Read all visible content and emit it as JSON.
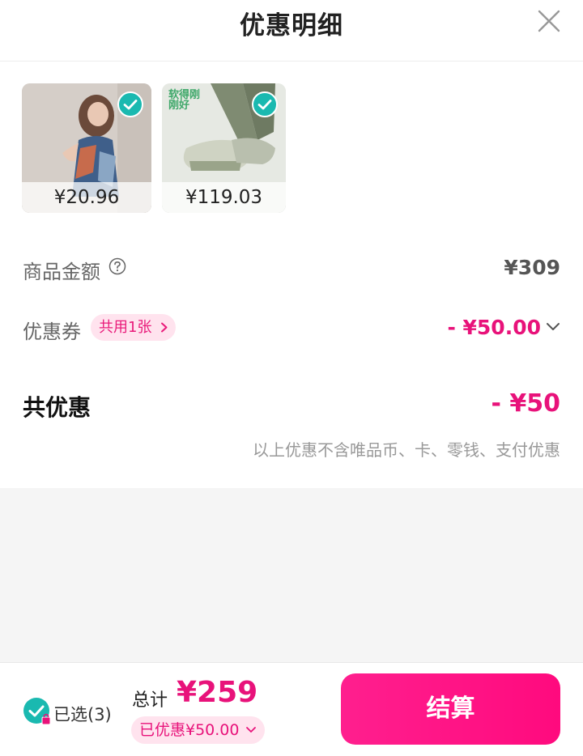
{
  "header": {
    "title": "优惠明细",
    "close_icon": "close-icon"
  },
  "products": [
    {
      "price": "¥20.96",
      "selected": true
    },
    {
      "price": "¥119.03",
      "selected": true,
      "brand_text": "软得刚刚好"
    }
  ],
  "summary": {
    "goods_amount_label": "商品金额",
    "goods_amount_value": "¥309",
    "coupon_label": "优惠券",
    "coupon_tag": "共用1张",
    "coupon_value": "- ¥50.00",
    "total_discount_label": "共优惠",
    "total_discount_value": "- ¥50",
    "note": "以上优惠不含唯品币、卡、零钱、支付优惠"
  },
  "footer": {
    "selected_text": "已选(3)",
    "total_label": "总计",
    "total_value": "¥259",
    "saved_text": "已优惠¥50.00",
    "checkout_label": "结算"
  },
  "colors": {
    "accent": "#e8127a",
    "check": "#1ab9b0",
    "checkout": "#ff0a7e"
  }
}
